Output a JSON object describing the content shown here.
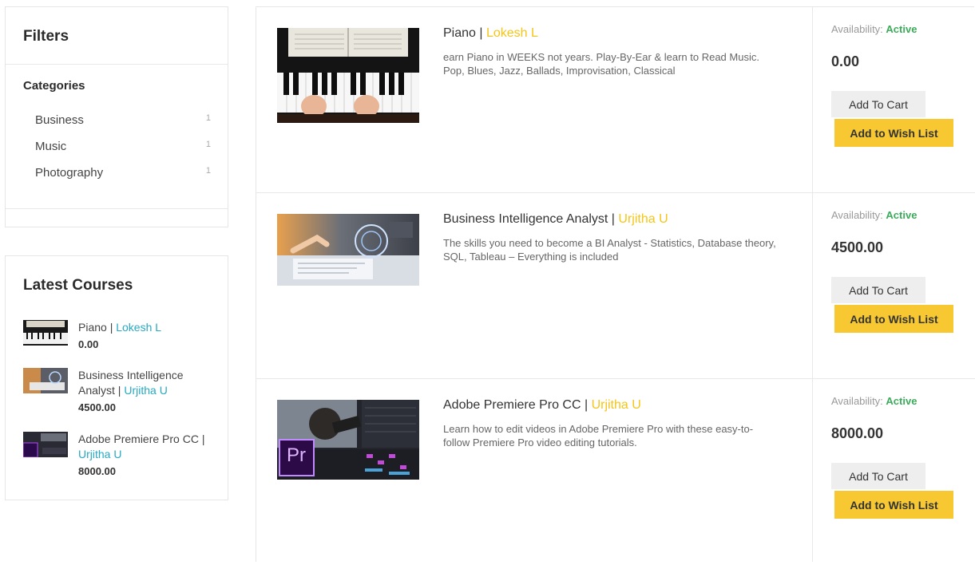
{
  "filters": {
    "title": "Filters",
    "categories_title": "Categories",
    "categories": [
      {
        "label": "Business",
        "count": "1"
      },
      {
        "label": "Music",
        "count": "1"
      },
      {
        "label": "Photography",
        "count": "1"
      }
    ]
  },
  "latest": {
    "title": "Latest Courses",
    "items": [
      {
        "name": "Piano",
        "author": "Lokesh L",
        "price": "0.00"
      },
      {
        "name": "Business Intelligence Analyst",
        "author": "Urjitha U",
        "price": "4500.00"
      },
      {
        "name": "Adobe Premiere Pro CC",
        "author": "Urjitha U",
        "price": "8000.00"
      }
    ]
  },
  "courses": [
    {
      "name": "Piano",
      "author": "Lokesh L",
      "description": "earn Piano in WEEKS not years. Play-By-Ear & learn to Read Music. Pop, Blues, Jazz, Ballads, Improvisation, Classical",
      "availability_label": "Availability:",
      "availability_status": "Active",
      "price": "0.00",
      "cart_label": "Add To Cart",
      "wish_label": "Add to Wish List"
    },
    {
      "name": "Business Intelligence Analyst",
      "author": "Urjitha U",
      "description": "The skills you need to become a BI Analyst - Statistics, Database theory, SQL, Tableau – Everything is included",
      "availability_label": "Availability:",
      "availability_status": "Active",
      "price": "4500.00",
      "cart_label": "Add To Cart",
      "wish_label": "Add to Wish List"
    },
    {
      "name": "Adobe Premiere Pro CC",
      "author": "Urjitha U",
      "description": "Learn how to edit videos in Adobe Premiere Pro with these easy-to-follow Premiere Pro video editing tutorials.",
      "availability_label": "Availability:",
      "availability_status": "Active",
      "price": "8000.00",
      "cart_label": "Add To Cart",
      "wish_label": "Add to Wish List"
    }
  ],
  "premiere_icon_text": "Pr",
  "separator": " | ",
  "colors": {
    "author_yellow": "#f5c518",
    "author_teal": "#27a9c2",
    "active_green": "#3cab5a",
    "wish_button": "#f7c832"
  }
}
